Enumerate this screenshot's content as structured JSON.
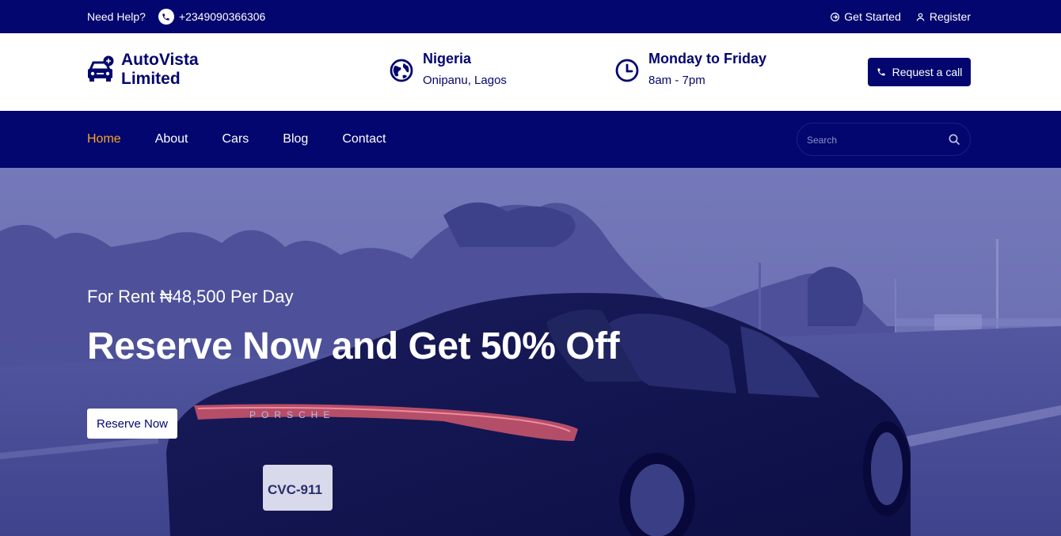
{
  "topbar": {
    "help_label": "Need Help?",
    "phone": "+2349090366306",
    "get_started": "Get Started",
    "register": "Register"
  },
  "header": {
    "brand_line1": "AutoVista",
    "brand_line2": "Limited",
    "location_title": "Nigeria",
    "location_sub": "Onipanu, Lagos",
    "hours_title": "Monday to Friday",
    "hours_sub": "8am - 7pm",
    "request_call": "Request a call"
  },
  "nav": {
    "items": [
      {
        "label": "Home",
        "active": true
      },
      {
        "label": "About"
      },
      {
        "label": "Cars"
      },
      {
        "label": "Blog"
      },
      {
        "label": "Contact"
      }
    ],
    "search_placeholder": "Search"
  },
  "hero": {
    "subtitle": "For Rent ₦48,500 Per Day",
    "title": "Reserve Now and Get 50% Off",
    "button": "Reserve Now",
    "plate_brand": "PORSCHE",
    "plate_number": "CVC-911"
  },
  "colors": {
    "primary": "#03066e",
    "accent": "#f5a623",
    "hero_overlay": "#6a6fb2"
  },
  "icons": [
    "phone-icon",
    "sign-in-icon",
    "user-icon",
    "car-logo-icon",
    "globe-icon",
    "clock-icon",
    "phone-icon",
    "search-icon"
  ]
}
